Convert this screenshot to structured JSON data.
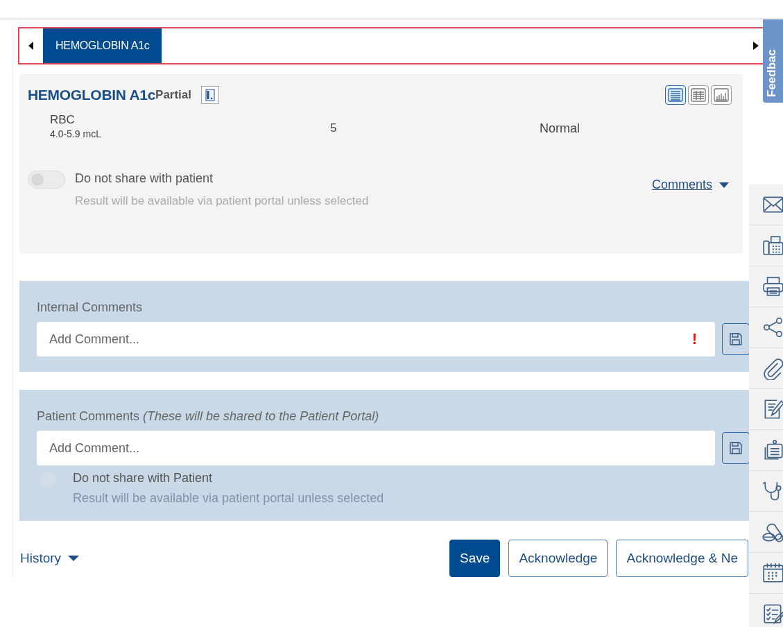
{
  "tabs": [
    {
      "label": "HEMOGLOBIN A1c",
      "selected": true
    }
  ],
  "result_card": {
    "title": "HEMOGLOBIN A1c",
    "status": "Partial",
    "views": [
      {
        "kind": "list",
        "selected": true
      },
      {
        "kind": "grid",
        "selected": false
      },
      {
        "kind": "chart",
        "selected": false
      }
    ],
    "rows": [
      {
        "name": "RBC",
        "range": "4.0-5.9 mcL",
        "value": "5",
        "flag": "Normal"
      }
    ],
    "share_toggle": {
      "label": "Do not share with patient",
      "note": "Result will be available via patient portal unless selected",
      "on": false
    },
    "comments_link": "Comments"
  },
  "internal_comments": {
    "label": "Internal Comments",
    "placeholder": "Add Comment...",
    "required_mark": "!"
  },
  "patient_comments": {
    "label": "Patient Comments *(These will be shared to the Patient Portal)*",
    "placeholder": "Add Comment...",
    "share_checkbox": {
      "label": "Do not share with Patient",
      "note": "Result will be available via patient portal unless selected",
      "checked": false
    }
  },
  "history_link": "History",
  "buttons": [
    {
      "label": "Save",
      "kind": "primary"
    },
    {
      "label": "Acknowledge",
      "kind": "secondary"
    },
    {
      "label": "Acknowledge & Ne",
      "kind": "secondary"
    }
  ],
  "side_toolbar": [
    {
      "kind": "mail"
    },
    {
      "kind": "fax"
    },
    {
      "kind": "print"
    },
    {
      "kind": "share"
    },
    {
      "kind": "attach"
    },
    {
      "kind": "note"
    },
    {
      "kind": "clipboard"
    },
    {
      "kind": "stethoscope"
    },
    {
      "kind": "pills"
    },
    {
      "kind": "calendar"
    },
    {
      "kind": "checklist"
    }
  ],
  "feedback_tab": {
    "label": "Feedbac"
  }
}
